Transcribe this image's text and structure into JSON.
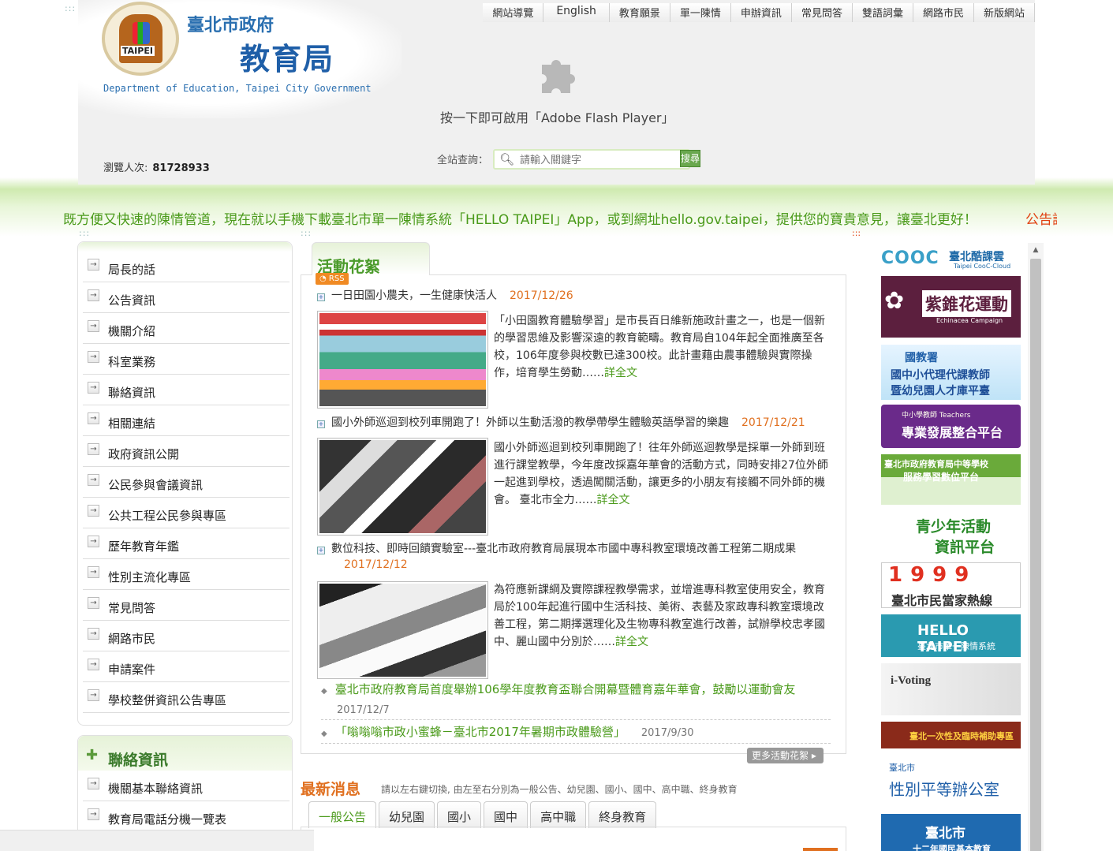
{
  "header": {
    "org_name": "臺北市政府",
    "bureau_name": "教育局",
    "org_en": "Department of Education, Taipei City Government",
    "logo_text": "TAIPEI",
    "top_nav": [
      "網站導覽",
      "English",
      "教育願景",
      "單一陳情",
      "申辦資訊",
      "常見問答",
      "雙語詞彙",
      "網路市民",
      "新版網站"
    ],
    "flash_text": "按一下即可啟用「Adobe Flash Player」",
    "visits_label": "瀏覽人次:",
    "visits_count": "81728933",
    "search_label": "全站查詢：",
    "search_placeholder": "請輸入關鍵字",
    "search_button": "搜尋"
  },
  "marquee": {
    "text": "既方便又快速的陳情管道，現在就以手機下載臺北市單一陳情系統「HELLO TAIPEI」App，或到網址hello.gov.taipei，提供您的寶貴意見，讓臺北更好！",
    "next": "公告訊"
  },
  "sidebar": {
    "items": [
      "局長的話",
      "公告資訊",
      "機關介紹",
      "科室業務",
      "聯絡資訊",
      "相關連結",
      "政府資訊公開",
      "公民參與會議資訊",
      "公共工程公民參與專區",
      "歷年教育年鑑",
      "性別主流化專區",
      "常見問答",
      "網路市民",
      "申請案件",
      "學校整併資訊公告專區"
    ],
    "contact_title": "聯絡資訊",
    "contact_items": [
      "機關基本聯絡資訊",
      "教育局電話分機一覽表"
    ]
  },
  "activity": {
    "tab": "活動花絮",
    "rss": "RSS",
    "news": [
      {
        "title": "一日田園小農夫，一生健康快活人",
        "date": "2017/12/26",
        "body": "「小田園教育體驗學習」是市長百日維新施政計畫之一，也是一個新的學習思維及影響深遠的教育範疇。教育局自104年起全面推廣至各校，106年度參與校數已達300校。此計畫藉由農事體驗與實際操作，培育學生勞動……",
        "more": "詳全文"
      },
      {
        "title": "國小外師巡迴到校列車開跑了！外師以生動活潑的教學帶學生體驗英語學習的樂趣",
        "date": "2017/12/21",
        "body": "國小外師巡迴到校列車開跑了！往年外師巡迴教學是採單一外師到班進行課堂教學，今年度改採嘉年華會的活動方式，同時安排27位外師一起進到學校，透過闖關活動，讓更多的小朋友有接觸不同外師的機會。 臺北市全力……",
        "more": "詳全文"
      },
      {
        "title": "數位科技、即時回饋實驗室---臺北市政府教育局展現本市國中專科教室環境改善工程第二期成果",
        "date": "2017/12/12",
        "body": "為符應新課綱及實際課程教學需求，並增進專科教室使用安全，教育局於100年起進行國中生活科技、美術、表藝及家政專科教室環境改善工程，第二期擇選理化及生物專科教室進行改善，試辦學校忠孝國中、麗山國中分別於……",
        "more": "詳全文"
      }
    ],
    "sub_items": [
      {
        "title": "臺北市政府教育局首度舉辦106學年度教育盃聯合開幕暨體育嘉年華會，鼓勵以運動會友",
        "date": "2017/12/7"
      },
      {
        "title": "「嗡嗡嗡市政小蜜蜂－臺北市2017年暑期市政體驗營」",
        "date": "2017/9/30"
      }
    ],
    "more_button": "更多活動花絮"
  },
  "latest": {
    "title": "最新消息",
    "hint": "請以左右鍵切換, 由左至右分別為一般公告、幼兒園、國小、國中、高中職、終身教育",
    "tabs": [
      "一般公告",
      "幼兒園",
      "國小",
      "國中",
      "高中職",
      "終身教育"
    ]
  },
  "banners": [
    {
      "line1": "COOC",
      "line2": "臺北酷課雲",
      "line3": "Taipei CooC-Cloud"
    },
    {
      "line1": "紫錐花運動",
      "line2": "Echinacea Campaign"
    },
    {
      "line1": "國教署",
      "line2": "國中小代理代課教師",
      "line3": "暨幼兒園人才庫平臺"
    },
    {
      "line1": "中小學教師 Teachers",
      "line2": "專業發展整合平台"
    },
    {
      "line1": "臺北市政府教育局中等學校",
      "line2": "服務學習數位平台"
    },
    {
      "line1": "青少年活動",
      "line2": "資訊平台"
    },
    {
      "line1": "1999",
      "line2": "臺北市民當家熱線"
    },
    {
      "line1": "HELLO TAIPEI",
      "line2": "臺北市單一陳情系統"
    },
    {
      "line1": "i-Voting"
    },
    {
      "line1": "臺北一次性及臨時補助專區"
    },
    {
      "line1": "臺北市",
      "line2": "性別平等辦公室"
    },
    {
      "line1": "臺北市",
      "line2": "十二年國民基本教育"
    }
  ],
  "colors": {
    "green": "#4a9a1a",
    "orange": "#e07020",
    "blue": "#1f5fa8"
  }
}
